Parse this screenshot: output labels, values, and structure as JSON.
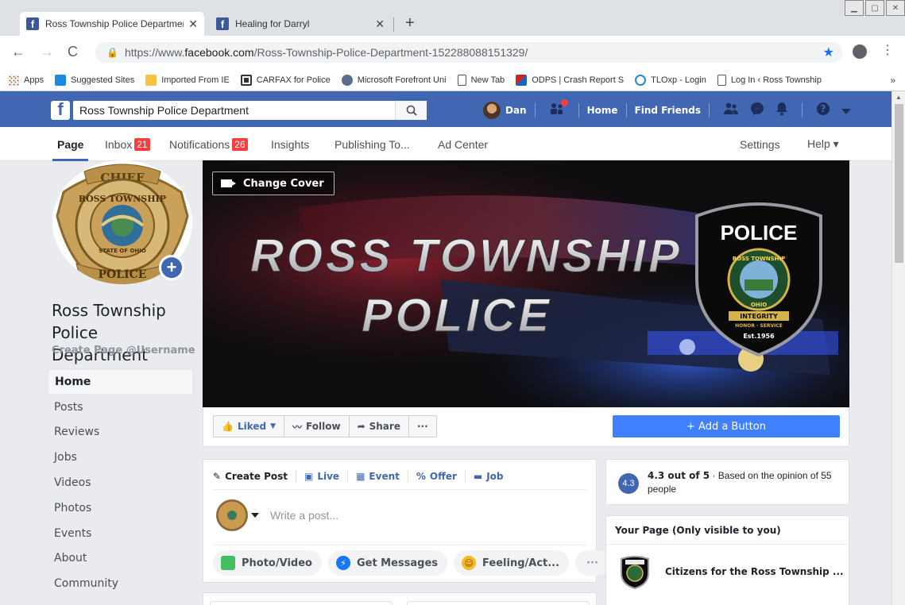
{
  "browser": {
    "tabs": [
      {
        "title": "Ross Township Police Department - H",
        "close": "✕"
      },
      {
        "title": "Healing for Darryl",
        "close": "✕"
      }
    ],
    "new_tab": "+",
    "url_prefix": "https://www.",
    "url_domain": "facebook.com",
    "url_path": "/Ross-Township-Police-Department-152288088151329/",
    "bookmarks": [
      {
        "label": "Apps",
        "color": "#e53935"
      },
      {
        "label": "Suggested Sites",
        "color": "#1e88e5"
      },
      {
        "label": "Imported From IE",
        "color": "#f6c342"
      },
      {
        "label": "CARFAX for Police",
        "color": "#333333"
      },
      {
        "label": "Microsoft Forefront Uni",
        "color": "#5b6d8c"
      },
      {
        "label": "New Tab",
        "color": "#ffffff"
      },
      {
        "label": "ODPS | Crash Report S",
        "color": "#c62828"
      },
      {
        "label": "TLOxp - Login",
        "color": "#1e88e5"
      },
      {
        "label": "Log In ‹ Ross Township",
        "color": "#ffffff"
      }
    ],
    "bookmarks_more": "»"
  },
  "fb": {
    "search_value": "Ross Township Police Department",
    "user_name": "Dan",
    "home": "Home",
    "find_friends": "Find Friends"
  },
  "page_tabs": {
    "page": "Page",
    "inbox": "Inbox",
    "inbox_count": "21",
    "notifications": "Notifications",
    "notifications_count": "26",
    "insights": "Insights",
    "publishing": "Publishing To...",
    "ad_center": "Ad Center",
    "settings": "Settings",
    "help": "Help ▾"
  },
  "profile": {
    "name_line1": "Ross Township",
    "name_line2": "Police Department",
    "username": "Create Page @Username",
    "badge_top": "CHIEF",
    "badge_ring": "ROSS TOWNSHIP",
    "badge_state": "STATE OF OHIO",
    "badge_bottom": "POLICE"
  },
  "left_nav": [
    "Home",
    "Posts",
    "Reviews",
    "Jobs",
    "Videos",
    "Photos",
    "Events",
    "About",
    "Community"
  ],
  "cover": {
    "change_cover": "Change Cover",
    "line1": "ROSS TOWNSHIP",
    "line2": "POLICE",
    "patch_title": "POLICE",
    "patch_ring": "ROSS TOWNSHIP",
    "patch_state": "OHIO",
    "patch_motto": "INTEGRITY",
    "patch_motto2": "HONOR · SERVICE",
    "patch_est": "Est.1956"
  },
  "actions": {
    "liked": "Liked",
    "follow": "Follow",
    "share": "Share",
    "more": "···",
    "add_button": "+ Add a Button"
  },
  "composer": {
    "create_post": "Create Post",
    "live": "Live",
    "event": "Event",
    "offer": "Offer",
    "job": "Job",
    "placeholder": "Write a post...",
    "photo_video": "Photo/Video",
    "get_messages": "Get Messages",
    "feeling": "Feeling/Act...",
    "more": "···"
  },
  "rating": {
    "score_badge": "4.3",
    "score_text": "4.3 out of 5",
    "detail": " · Based on the opinion of 55 people"
  },
  "your_page": {
    "heading": "Your Page (Only visible to you)",
    "item": "Citizens for the Ross Township ..."
  }
}
